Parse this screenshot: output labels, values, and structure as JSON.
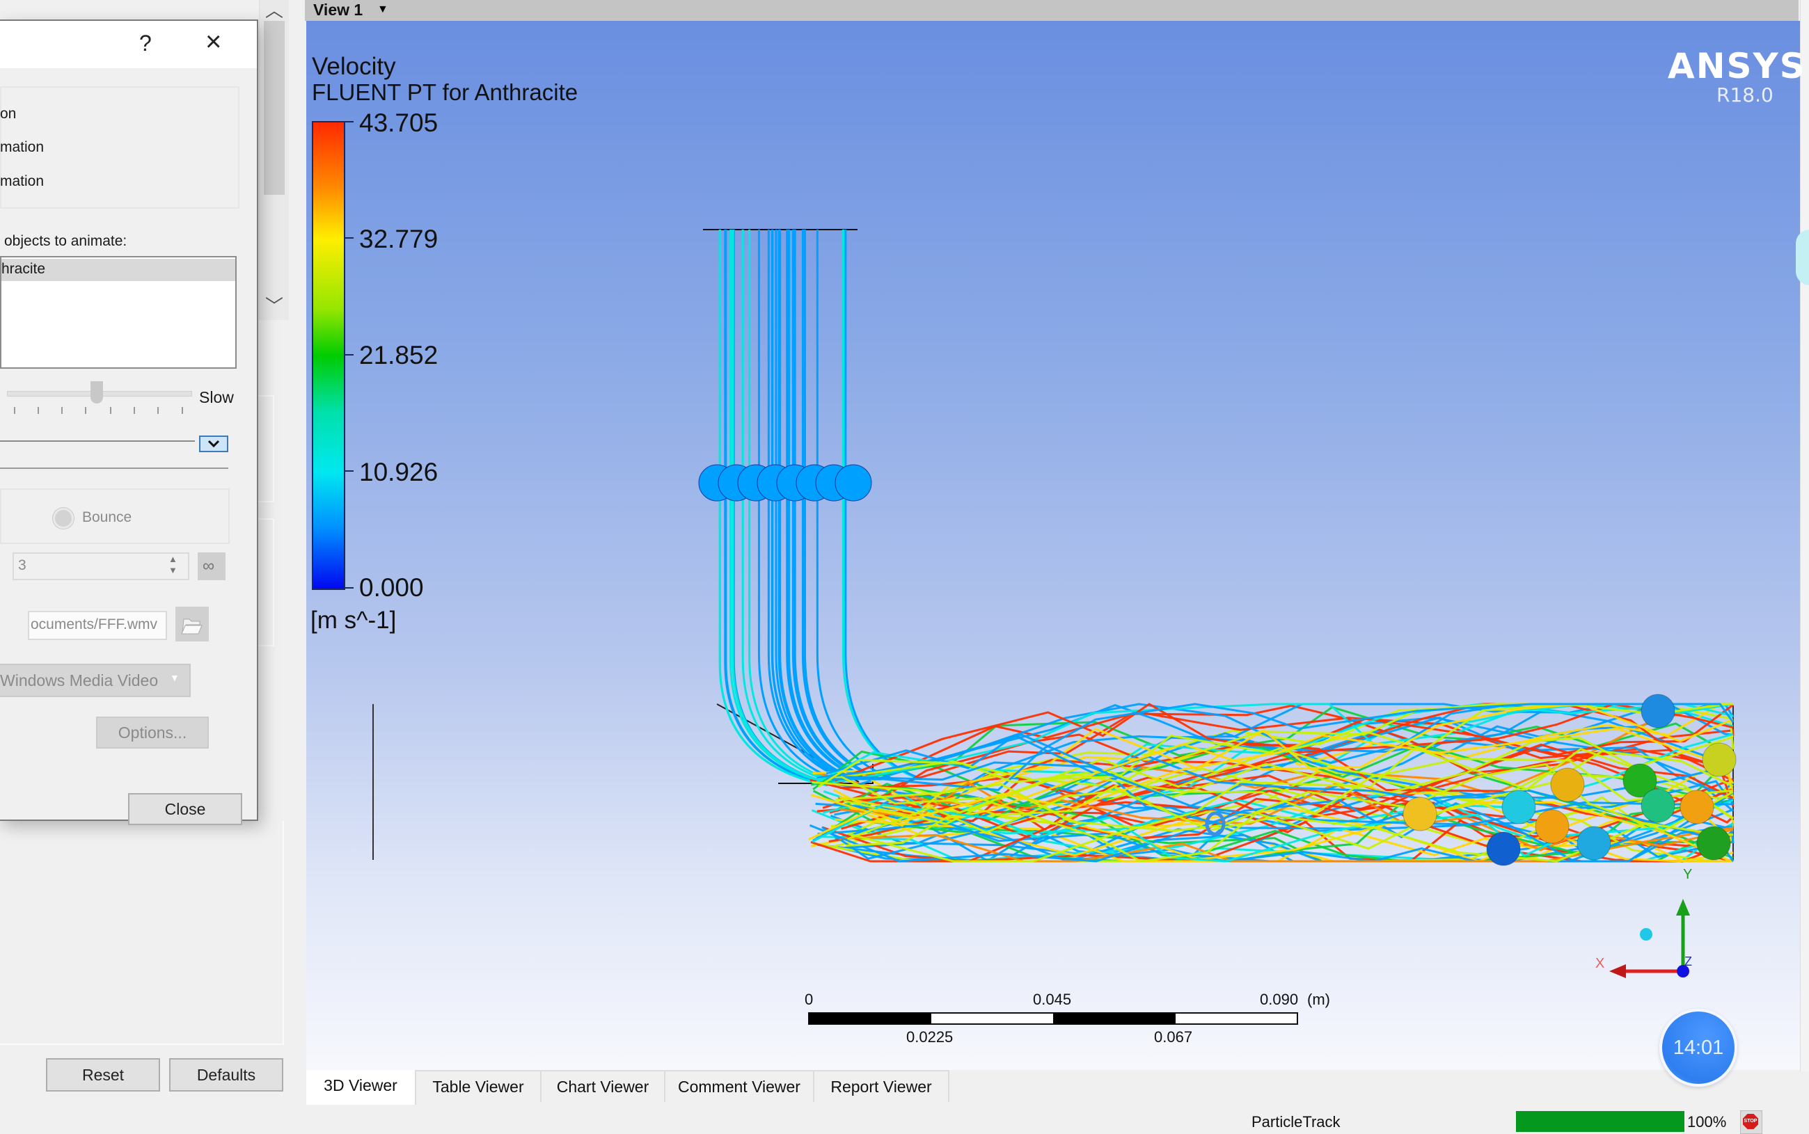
{
  "dialog": {
    "help_icon": "?",
    "close_icon": "×",
    "options_partial": [
      "on",
      "mation",
      "mation"
    ],
    "objects_label": "objects to animate:",
    "objects_list": [
      "hracite"
    ],
    "speed_label": "Slow",
    "speed_value_fraction": 0.5,
    "bounce_label": "Bounce",
    "repeat_value": "3",
    "infinite_label": "∞",
    "file_path": "ocuments/FFF.wmv",
    "format_value": "Windows Media Video",
    "options_button": "Options...",
    "close_button": "Close"
  },
  "left_panel": {
    "reset_button": "Reset",
    "defaults_button": "Defaults"
  },
  "viewer": {
    "view_tab": "View 1",
    "legend": {
      "variable": "Velocity",
      "subtitle": "FLUENT PT for Anthracite",
      "ticks": [
        "43.705",
        "32.779",
        "21.852",
        "10.926",
        "0.000"
      ],
      "units": "[m s^-1]",
      "min": 0.0,
      "max": 43.705
    },
    "brand": "ANSYS",
    "version": "R18.0",
    "scale_bar": {
      "top_labels": [
        "0",
        "0.045",
        "0.090"
      ],
      "bottom_labels": [
        "0.0225",
        "0.067"
      ],
      "unit": "(m)"
    },
    "axes": {
      "x": "X",
      "y": "Y",
      "z": "Z"
    },
    "colors": {
      "x_axis": "#e02020",
      "y_axis": "#18a018",
      "z_axis": "#1010e0"
    }
  },
  "bottom_tabs": [
    "3D Viewer",
    "Table Viewer",
    "Chart Viewer",
    "Comment Viewer",
    "Report Viewer"
  ],
  "active_tab": "3D Viewer",
  "timer": "14:01",
  "status": {
    "label": "ParticleTrack",
    "progress_percent": 100,
    "progress_text": "100%",
    "stop_icon": "STOP"
  }
}
